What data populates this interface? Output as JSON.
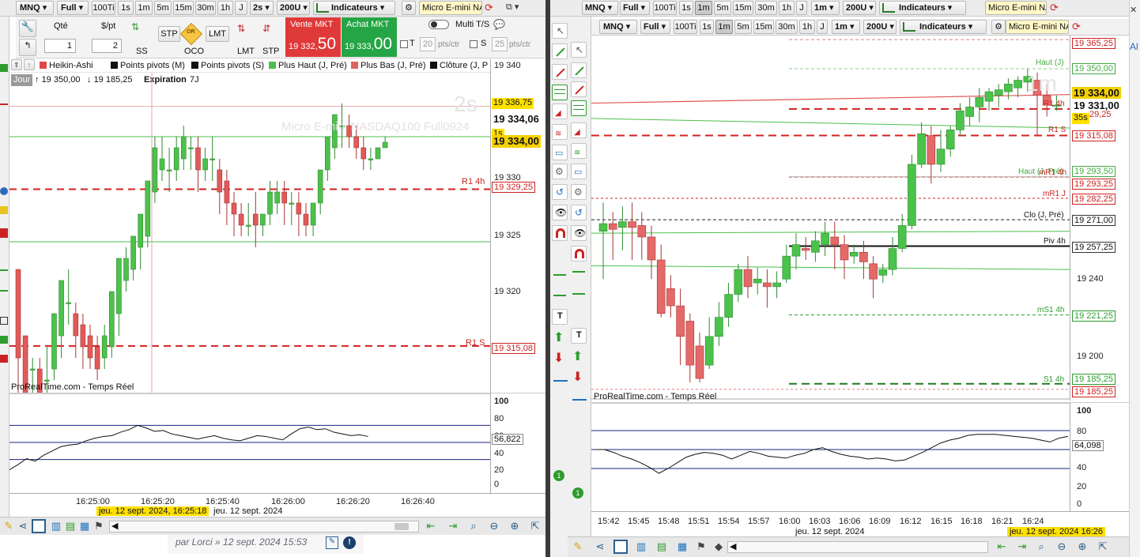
{
  "left": {
    "toolbar": {
      "symbol": "MNQ",
      "mode": "Full",
      "timeframes": [
        "100Ti",
        "1s",
        "1m",
        "5m",
        "15m",
        "30m",
        "1h",
        "J"
      ],
      "interval": "2s",
      "units": "200U",
      "indicators_label": "Indicateurs",
      "instrument": "Micro E-mini NA"
    },
    "order_panel": {
      "qty_label": "Qté",
      "qty_value": "1",
      "per_pt_label": "$/pt",
      "per_pt_value": "2",
      "ss_label": "SS",
      "stp_label": "STP",
      "or_label": "OR",
      "lmt_label": "LMT",
      "oco_label": "OCO",
      "lmt2_label": "LMT",
      "stp2_label": "STP",
      "sell_label": "Vente MKT",
      "sell_small": "19 332,",
      "sell_big": "50",
      "buy_label": "Achat MKT",
      "buy_small": "19 333,",
      "buy_big": "00",
      "multi_label": "Multi T/S",
      "t_label": "T",
      "t_value": "20",
      "s_label": "S",
      "s_value": "25",
      "pts_label": "pts/ctr"
    },
    "legend": [
      {
        "label": "Heikin-Ashi",
        "color": "#66cc66"
      },
      {
        "label": "Points pivots (M)",
        "color": "#222222"
      },
      {
        "label": "Points pivots (S)",
        "color": "#222222"
      },
      {
        "label": "Plus Haut (J, Pré)",
        "color": "#44bb44"
      },
      {
        "label": "Plus Bas (J, Pré)",
        "color": "#e05555"
      },
      {
        "label": "Clôture (J, P",
        "color": "#111111"
      }
    ],
    "info": {
      "period": "Jour",
      "high": "19 350,00",
      "low": "19 185,25",
      "expiry_label": "Expiration",
      "expiry_value": "7J"
    },
    "watermark_tf": "2s",
    "watermark_name": "Micro E-mini NASDAQ100 Full0924",
    "price_axis": [
      "19 340",
      "19 330",
      "19 325",
      "19 320"
    ],
    "price_labels": {
      "r1_4h": "19 336,75",
      "last": "19 334,06",
      "countdown": "1s",
      "current": "19 334,00",
      "r1_4h_line": "19 329,25",
      "r1_s": "19 315,08"
    },
    "line_labels": {
      "r1_4h": "R1 4h",
      "r1_s": "R1 S"
    },
    "brand": "ProRealTime.com - Temps Réel",
    "osc_axis": [
      "100",
      "80",
      "60",
      "40",
      "20",
      "0"
    ],
    "osc_value": "56,822",
    "time_axis": [
      "16:25:00",
      "16:25:20",
      "16:25:40",
      "16:26:00",
      "16:26:20",
      "16:26:40"
    ],
    "cursor_date": "jeu. 12 sept. 2024, 16:25:18",
    "date_label": "jeu. 12 sept. 2024",
    "post_footer": "par Lorci » 12 sept. 2024 15:53"
  },
  "right": {
    "toolbar_top": {
      "symbol": "MNQ",
      "mode": "Full",
      "timeframes": [
        "100Ti",
        "1s",
        "1m",
        "5m",
        "15m",
        "30m",
        "1h",
        "J"
      ],
      "interval": "1m",
      "units": "200U",
      "indicators_label": "Indicateurs",
      "instrument": "Micro E-mini NA"
    },
    "toolbar": {
      "symbol": "MNQ",
      "mode": "Full",
      "timeframes": [
        "100Ti",
        "1s",
        "1m",
        "5m",
        "15m",
        "30m",
        "1h",
        "J"
      ],
      "interval": "1m",
      "units": "200U",
      "indicators_label": "Indicateurs",
      "instrument": "Micro E-mini NA"
    },
    "watermark_tf": "1m",
    "price_axis": [
      "19 240",
      "19 200"
    ],
    "price_labels": {
      "top": "19 365,25",
      "haut_j": "19 350,00",
      "current": "19 334,00",
      "last": "19 331,00",
      "p1": "29,25",
      "countdown": "35s",
      "r1_s": "19 315,08",
      "haut_4h": "19 293,50",
      "mr1_4h": "19 293,25",
      "mr1_j": "19 282,25",
      "clo": "19 271,00",
      "piv_4h": "19 257,25",
      "ms1_4h": "19 221,25",
      "bs1_4h": "19 185,25",
      "bottom": "19 185,25"
    },
    "line_labels": {
      "haut_j": "Haut (J)",
      "r1_4h": "R1 4h",
      "r1_s": "R1 S",
      "haut_4h": "Haut (J, Pré)",
      "mr1_4h": "mR1 4h",
      "mr1_j": "mR1 J",
      "clo": "Clo (J, Pré)",
      "piv_4h": "Piv 4h",
      "ms1_4h": "mS1 4h",
      "bs1_4h": "S1 4h"
    },
    "brand": "ProRealTime.com - Temps Réel",
    "osc_axis": [
      "100",
      "80",
      "60",
      "40",
      "20",
      "0"
    ],
    "osc_value": "64,098",
    "time_axis": [
      "15:42",
      "15:45",
      "15:48",
      "15:51",
      "15:54",
      "15:57",
      "16:00",
      "16:03",
      "16:06",
      "16:09",
      "16:12",
      "16:15",
      "16:18",
      "16:21",
      "16:24"
    ],
    "date_label": "jeu. 12 sept. 2024",
    "cursor_date": "jeu. 12 sept. 2024 16:26",
    "side_text": "Al"
  },
  "left_candles": [
    [
      19322.0,
      19322.0,
      19314.0,
      19310.0
    ],
    [
      19316.0,
      19316.0,
      19308.0,
      19306.0
    ],
    [
      19313.0,
      19314.0,
      19313.0,
      19310.0
    ],
    [
      19313.0,
      19314.0,
      19310.0,
      19306.0
    ],
    [
      19312.0,
      19315.0,
      19312.0,
      19310.0
    ],
    [
      19313.0,
      19318.0,
      19318.0,
      19312.0
    ],
    [
      19316.0,
      19321.0,
      19321.0,
      19314.0
    ],
    [
      19319.0,
      19322.0,
      19319.0,
      19317.0
    ],
    [
      19318.0,
      19319.0,
      19316.0,
      19314.0
    ],
    [
      19317.0,
      19318.0,
      19315.0,
      19313.0
    ],
    [
      19316.0,
      19317.0,
      19314.0,
      19313.0
    ],
    [
      19315.0,
      19316.0,
      19313.0,
      19312.0
    ],
    [
      19314.0,
      19317.0,
      19316.0,
      19313.0
    ],
    [
      19315.0,
      19320.0,
      19320.0,
      19314.0
    ],
    [
      19318.0,
      19323.0,
      19323.0,
      19316.0
    ],
    [
      19321.0,
      19324.0,
      19323.0,
      19320.0
    ],
    [
      19322.0,
      19325.0,
      19325.0,
      19321.0
    ],
    [
      19324.0,
      19327.0,
      19327.0,
      19322.0
    ],
    [
      19325.0,
      19330.0,
      19330.0,
      19324.0
    ],
    [
      19329.0,
      19334.0,
      19333.0,
      19328.0
    ],
    [
      19331.0,
      19334.0,
      19332.0,
      19330.0
    ],
    [
      19331.0,
      19333.0,
      19331.0,
      19329.0
    ],
    [
      19331.0,
      19334.0,
      19333.0,
      19330.0
    ],
    [
      19332.0,
      19335.0,
      19334.0,
      19331.0
    ],
    [
      19333.0,
      19334.0,
      19333.0,
      19331.0
    ],
    [
      19333.0,
      19334.0,
      19331.0,
      19329.0
    ],
    [
      19331.0,
      19333.0,
      19332.0,
      19330.0
    ],
    [
      19332.0,
      19334.0,
      19332.0,
      19330.0
    ],
    [
      19331.0,
      19332.0,
      19329.0,
      19327.0
    ],
    [
      19330.0,
      19331.0,
      19328.0,
      19326.0
    ],
    [
      19328.0,
      19329.0,
      19327.0,
      19325.0
    ],
    [
      19327.0,
      19328.0,
      19326.0,
      19325.0
    ],
    [
      19326.0,
      19328.0,
      19326.0,
      19325.0
    ],
    [
      19327.0,
      19329.0,
      19326.0,
      19324.0
    ],
    [
      19326.0,
      19327.0,
      19327.0,
      19325.0
    ],
    [
      19327.0,
      19330.0,
      19329.0,
      19326.0
    ],
    [
      19328.0,
      19330.0,
      19329.0,
      19327.0
    ],
    [
      19329.0,
      19330.0,
      19328.0,
      19326.0
    ],
    [
      19328.0,
      19329.0,
      19328.0,
      19326.0
    ],
    [
      19328.0,
      19329.0,
      19327.0,
      19325.0
    ],
    [
      19327.0,
      19328.0,
      19326.0,
      19325.0
    ],
    [
      19326.0,
      19328.0,
      19328.0,
      19325.0
    ],
    [
      19328.0,
      19331.0,
      19331.0,
      19327.0
    ],
    [
      19331.0,
      19334.0,
      19334.0,
      19330.0
    ],
    [
      19333.0,
      19336.0,
      19336.0,
      19332.0
    ],
    [
      19335.0,
      19337.0,
      19335.0,
      19333.0
    ],
    [
      19335.0,
      19336.0,
      19334.0,
      19333.0
    ],
    [
      19334.0,
      19335.0,
      19333.0,
      19332.0
    ],
    [
      19333.0,
      19334.0,
      19332.0,
      19331.0
    ],
    [
      19332.0,
      19333.0,
      19332.0,
      19331.0
    ],
    [
      19332.0,
      19333.0,
      19333.0,
      19332.0
    ],
    [
      19333.0,
      19334.0,
      19333.5,
      19333.0
    ]
  ],
  "right_candles": [
    [
      19265,
      19280,
      19269,
      19240
    ],
    [
      19269,
      19275,
      19266,
      19250
    ],
    [
      19267,
      19278,
      19270,
      19255
    ],
    [
      19270,
      19280,
      19267,
      19250
    ],
    [
      19268,
      19275,
      19262,
      19250
    ],
    [
      19262,
      19268,
      19250,
      19240
    ],
    [
      19250,
      19258,
      19222,
      19220
    ],
    [
      19235,
      19242,
      19226,
      19220
    ],
    [
      19226,
      19235,
      19210,
      19195
    ],
    [
      19218,
      19222,
      19195,
      19186
    ],
    [
      19205,
      19212,
      19188,
      19186
    ],
    [
      19195,
      19220,
      19210,
      19193
    ],
    [
      19210,
      19228,
      19220,
      19205
    ],
    [
      19220,
      19238,
      19232,
      19215
    ],
    [
      19232,
      19248,
      19245,
      19228
    ],
    [
      19245,
      19252,
      19236,
      19230
    ],
    [
      19238,
      19246,
      19240,
      19232
    ],
    [
      19238,
      19245,
      19236,
      19225
    ],
    [
      19236,
      19244,
      19238,
      19230
    ],
    [
      19240,
      19258,
      19252,
      19238
    ],
    [
      19252,
      19264,
      19258,
      19245
    ],
    [
      19256,
      19262,
      19255,
      19250
    ],
    [
      19254,
      19265,
      19260,
      19249
    ],
    [
      19258,
      19270,
      19264,
      19252
    ],
    [
      19262,
      19270,
      19258,
      19245
    ],
    [
      19258,
      19263,
      19250,
      19240
    ],
    [
      19252,
      19258,
      19254,
      19248
    ],
    [
      19254,
      19260,
      19249,
      19240
    ],
    [
      19248,
      19252,
      19240,
      19230
    ],
    [
      19242,
      19248,
      19245,
      19238
    ],
    [
      19245,
      19262,
      19256,
      19242
    ],
    [
      19256,
      19274,
      19268,
      19254
    ],
    [
      19268,
      19305,
      19300,
      19266
    ],
    [
      19300,
      19322,
      19316,
      19298
    ],
    [
      19315,
      19320,
      19300,
      19290
    ],
    [
      19300,
      19318,
      19308,
      19296
    ],
    [
      19308,
      19320,
      19318,
      19304
    ],
    [
      19318,
      19332,
      19328,
      19315
    ],
    [
      19325,
      19335,
      19330,
      19320
    ],
    [
      19330,
      19340,
      19335,
      19322
    ],
    [
      19333,
      19340,
      19338,
      19328
    ],
    [
      19336,
      19342,
      19339,
      19330
    ],
    [
      19338,
      19345,
      19342,
      19334
    ],
    [
      19340,
      19346,
      19344,
      19335
    ],
    [
      19343,
      19350,
      19346,
      19338
    ],
    [
      19344,
      19348,
      19336,
      19315
    ],
    [
      19336,
      19342,
      19331,
      19325
    ],
    [
      19331,
      19336,
      19331,
      19328
    ]
  ],
  "left_osc": [
    18,
    24,
    31,
    28,
    35,
    40,
    45,
    47,
    48,
    52,
    55,
    57,
    58,
    62,
    65,
    70,
    67,
    63,
    64,
    60,
    58,
    56,
    54,
    56,
    58,
    55,
    53,
    52,
    55,
    58,
    57,
    55,
    53,
    60,
    66,
    68,
    65,
    66,
    62,
    60,
    58,
    59,
    57
  ],
  "right_osc": [
    50,
    50,
    47,
    43,
    40,
    36,
    31,
    25,
    30,
    36,
    42,
    45,
    47,
    46,
    44,
    40,
    44,
    48,
    46,
    43,
    42,
    41,
    44,
    46,
    50,
    52,
    48,
    45,
    43,
    42,
    40,
    41,
    40,
    38,
    39,
    43,
    47,
    52,
    57,
    60,
    62,
    65,
    66,
    66,
    66,
    65,
    64,
    63,
    62,
    60,
    58,
    62,
    64
  ]
}
